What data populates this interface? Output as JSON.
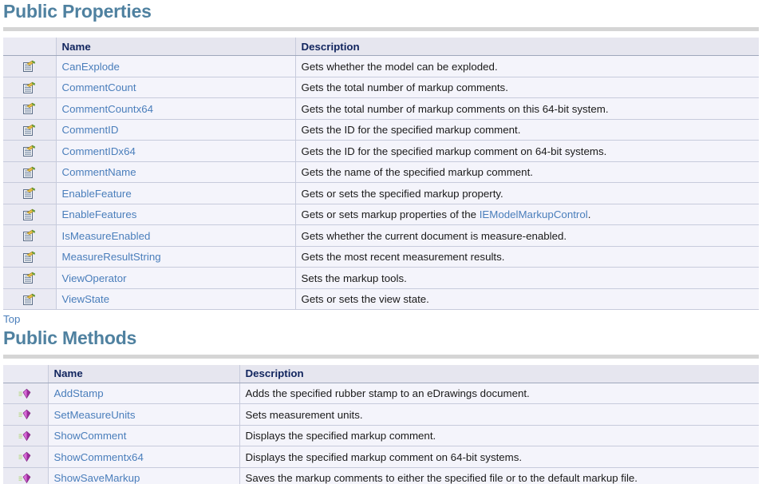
{
  "sections": [
    {
      "id": "public-properties",
      "heading": "Public Properties",
      "table": {
        "columns": {
          "icon": "",
          "name": "Name",
          "description": "Description"
        },
        "icon_name": "property-icon",
        "rows": [
          {
            "name": "CanExplode",
            "description": "Gets whether the model can be exploded."
          },
          {
            "name": "CommentCount",
            "description": "Gets the total number of markup comments."
          },
          {
            "name": "CommentCountx64",
            "description": "Gets the total number of markup comments on this 64-bit system."
          },
          {
            "name": "CommentID",
            "description": "Gets the ID for the specified markup comment."
          },
          {
            "name": "CommentIDx64",
            "description": "Gets the ID for the specified markup comment on 64-bit systems."
          },
          {
            "name": "CommentName",
            "description": "Gets the name of the specified markup comment."
          },
          {
            "name": "EnableFeature",
            "description": "Gets or sets the specified markup property."
          },
          {
            "name": "EnableFeatures",
            "description": "Gets or sets markup properties of the ",
            "description_link": "IEModelMarkupControl",
            "description_tail": "."
          },
          {
            "name": "IsMeasureEnabled",
            "description": "Gets whether the current document is measure-enabled."
          },
          {
            "name": "MeasureResultString",
            "description": "Gets the most recent measurement results."
          },
          {
            "name": "ViewOperator",
            "description": "Sets the markup tools."
          },
          {
            "name": "ViewState",
            "description": "Gets or sets the view state."
          }
        ]
      },
      "top_link": "Top"
    },
    {
      "id": "public-methods",
      "heading": "Public Methods",
      "table": {
        "columns": {
          "icon": "",
          "name": "Name",
          "description": "Description"
        },
        "icon_name": "method-icon",
        "rows": [
          {
            "name": "AddStamp",
            "description": "Adds the specified rubber stamp to an eDrawings document."
          },
          {
            "name": "SetMeasureUnits",
            "description": "Sets measurement units."
          },
          {
            "name": "ShowComment",
            "description": "Displays the specified markup comment."
          },
          {
            "name": "ShowCommentx64",
            "description": "Displays the specified markup comment on 64-bit systems."
          },
          {
            "name": "ShowSaveMarkup",
            "description": "Saves the markup comments to either the specified file or to the default markup file."
          }
        ]
      }
    }
  ],
  "colors": {
    "heading": "#4F81A0",
    "link": "#4A7EBB",
    "header_row_bg": "#E6E6EF",
    "row_bg": "#F4F4FB",
    "icon_col_bg": "#EAEAF3",
    "border": "#C7CBDC",
    "rule": "#D5D5D5",
    "column_header_text": "#11255E"
  }
}
